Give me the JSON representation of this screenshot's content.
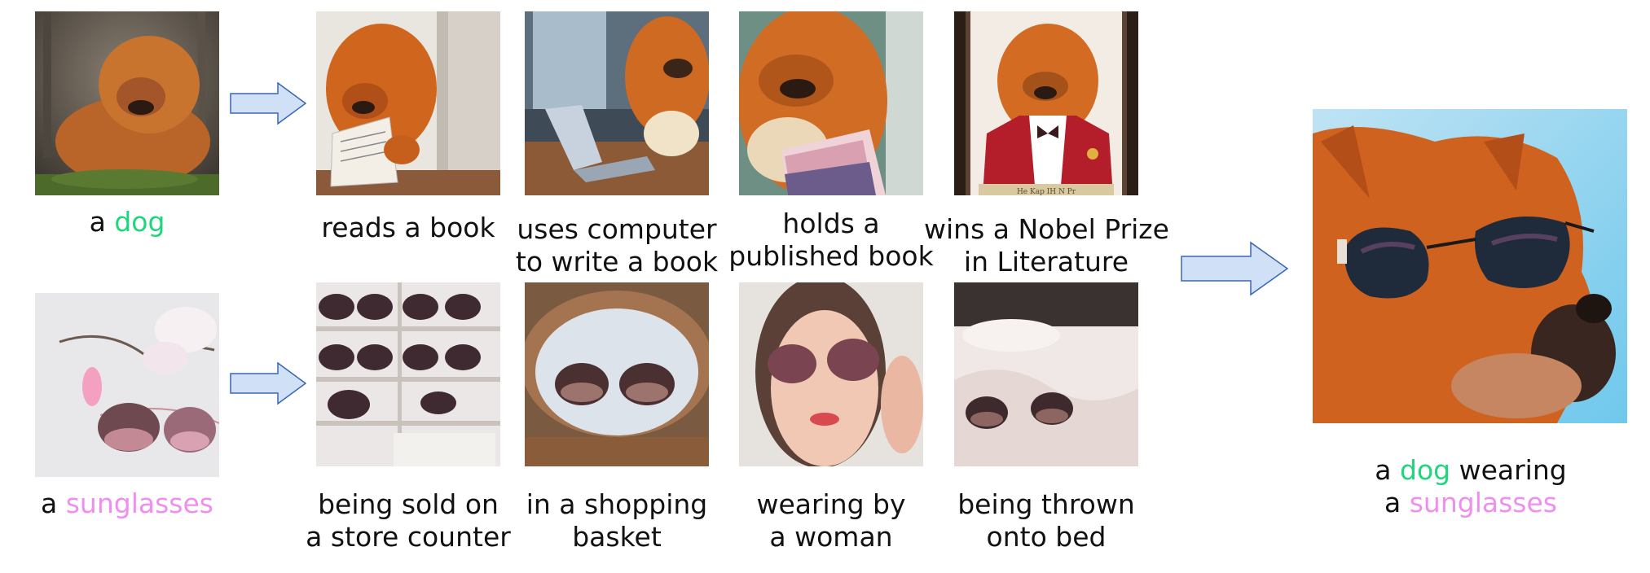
{
  "source": {
    "dog": {
      "prefix": "a ",
      "word": "dog"
    },
    "sunglasses": {
      "prefix": "a ",
      "word": "sunglasses"
    }
  },
  "dog_row": [
    {
      "line1": "reads a book",
      "line2": ""
    },
    {
      "line1": "uses computer",
      "line2": "to write a book"
    },
    {
      "line1": "holds a",
      "line2": "published book"
    },
    {
      "line1": "wins a Nobel Prize",
      "line2": "in Literature"
    }
  ],
  "sunglasses_row": [
    {
      "line1": "being sold on",
      "line2": "a store counter"
    },
    {
      "line1": "in a shopping",
      "line2": "basket"
    },
    {
      "line1": "wearing by",
      "line2": "a woman"
    },
    {
      "line1": "being thrown",
      "line2": "onto bed"
    }
  ],
  "result": {
    "a1": "a ",
    "w1": "dog",
    "mid": " wearing",
    "a2": "a ",
    "w2": "sunglasses"
  },
  "plaque_text": "He Kap IH N Pr",
  "colors": {
    "subject": "#1fd67c",
    "object": "#f08ef0",
    "arrow_fill": "#cfe0f7",
    "arrow_stroke": "#3a67b0"
  }
}
